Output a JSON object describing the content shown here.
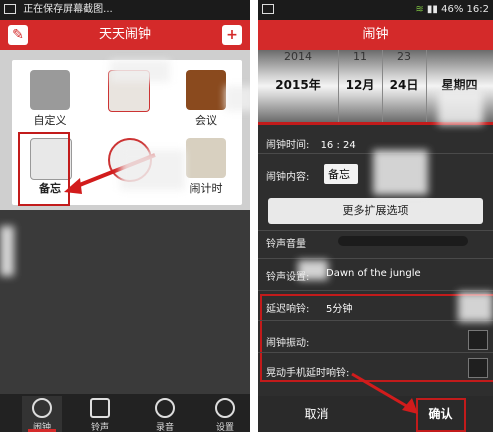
{
  "left": {
    "status_text": "正在保存屏幕截图...",
    "title": "天天闹钟",
    "popup_items": [
      {
        "label": "自定义"
      },
      {
        "label": ""
      },
      {
        "label": "会议"
      },
      {
        "label": "备忘"
      },
      {
        "label": ""
      },
      {
        "label": "闹计时"
      }
    ],
    "nav": [
      "闹钟",
      "铃声",
      "录音",
      "设置"
    ]
  },
  "right": {
    "status_time": "16:2",
    "battery": "46%",
    "title": "闹钟",
    "drum": {
      "year_top": "2014",
      "month_top": "11",
      "day_top": "23",
      "year": "2015年",
      "month": "12月",
      "day": "24日",
      "weekday": "星期四"
    },
    "alarm_time_label": "闹钟时间:",
    "alarm_time_value": "16 : 24",
    "content_label": "闹钟内容:",
    "content_value": "备忘",
    "more_options": "更多扩展选项",
    "volume_label": "铃声音量",
    "ringtone_label": "铃声设置:",
    "ringtone_value": "Dawn of the jungle",
    "delay_label": "延迟响铃:",
    "delay_value": "5分钟",
    "vibrate_label": "闹钟振动:",
    "shake_label": "晃动手机延时响铃:",
    "cancel": "取消",
    "confirm": "确认"
  },
  "colors": {
    "accent": "#d42a2a",
    "highlight": "#c21b1b"
  }
}
